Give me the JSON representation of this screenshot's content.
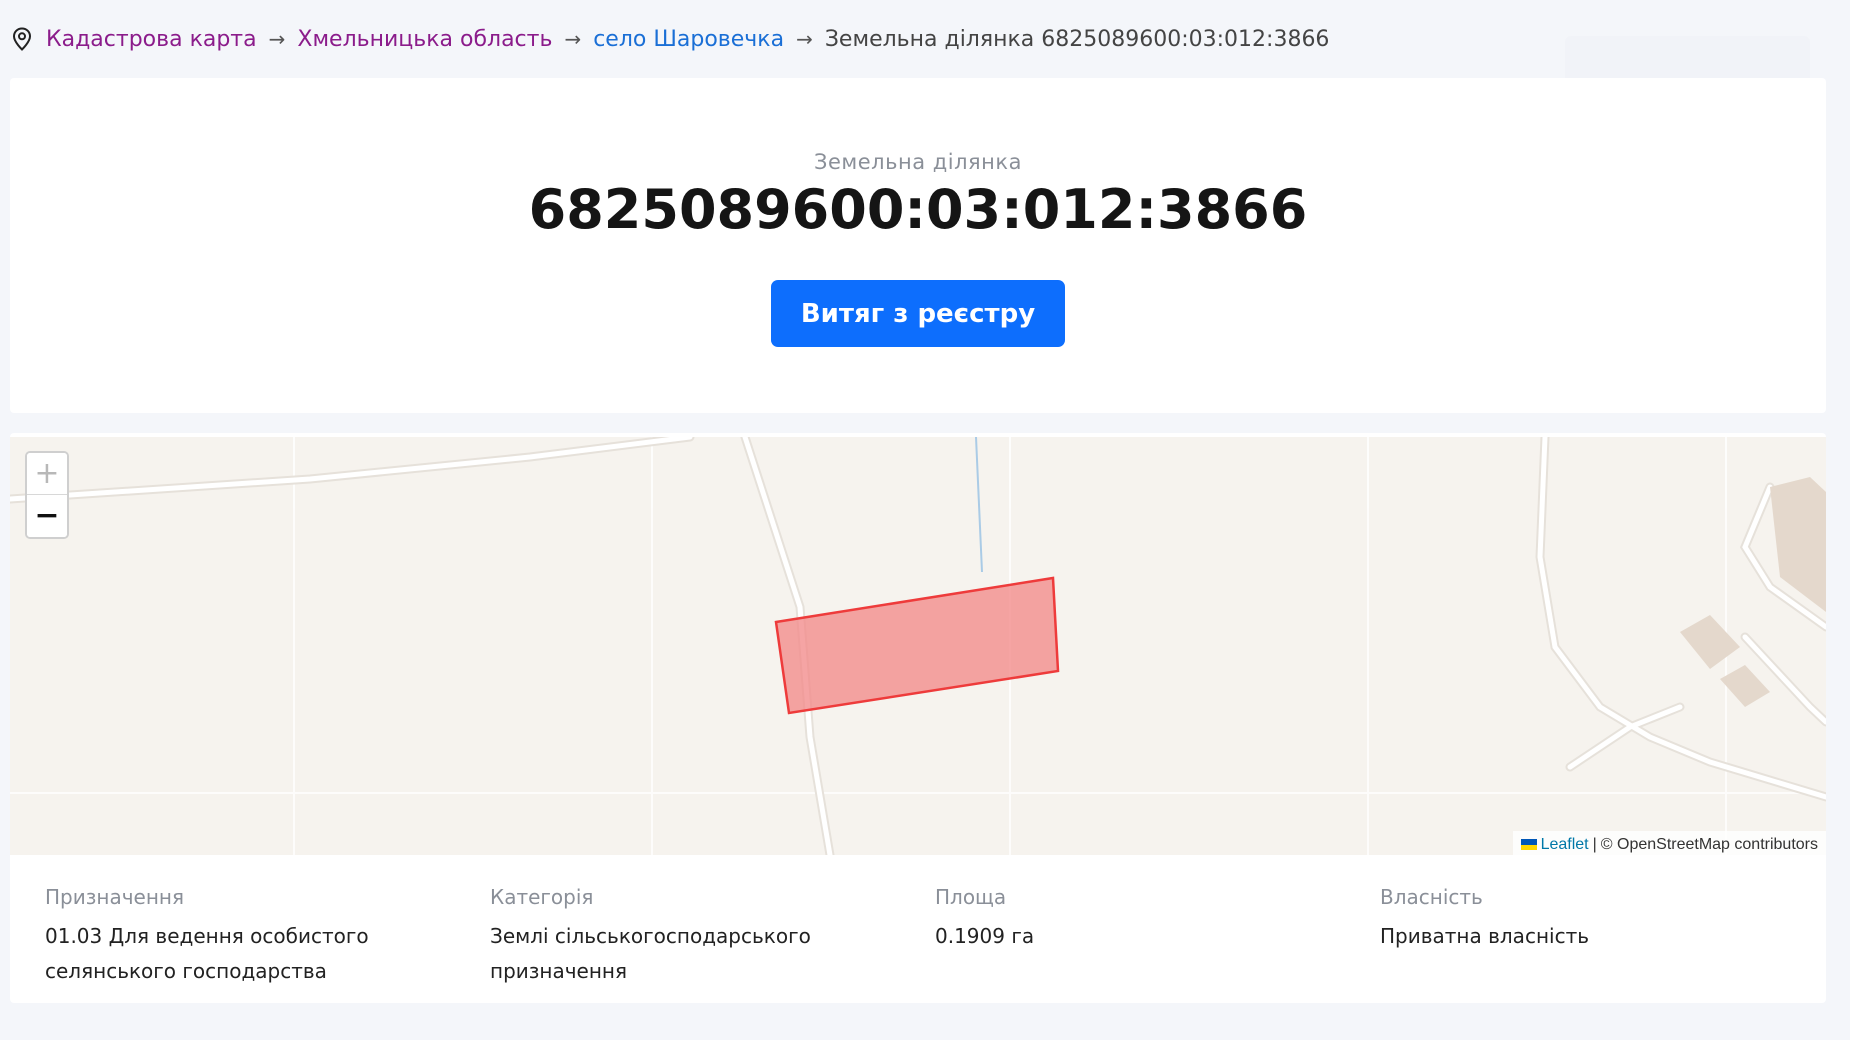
{
  "breadcrumb": {
    "items": [
      {
        "label": "Кадастрова карта",
        "state": "visited"
      },
      {
        "label": "Хмельницька область",
        "state": "visited"
      },
      {
        "label": "село Шаровечка",
        "state": "link"
      },
      {
        "label": "Земельна ділянка 6825089600:03:012:3866",
        "state": "current"
      }
    ],
    "separator": "→",
    "icon": "location-pin-icon"
  },
  "header": {
    "subtitle": "Земельна ділянка",
    "title": "6825089600:03:012:3866",
    "button_label": "Витяг з реєстру"
  },
  "map": {
    "zoom_in_label": "+",
    "zoom_out_label": "−",
    "attribution": {
      "leaflet_label": "Leaflet",
      "separator": "|",
      "osm_label": "© OpenStreetMap contributors"
    },
    "parcel_color": "#ee3b3b",
    "parcel_fill": "#f28a8a"
  },
  "properties": [
    {
      "label": "Призначення",
      "value": "01.03 Для ведення особистого селянського господарства"
    },
    {
      "label": "Категорія",
      "value": "Землі сільськогосподарського призначення"
    },
    {
      "label": "Площа",
      "value": "0.1909 га"
    },
    {
      "label": "Власність",
      "value": "Приватна власність"
    }
  ],
  "colors": {
    "accent": "#0d6efd",
    "visited_link": "#8b1c8b",
    "link": "#1a6fd6"
  }
}
